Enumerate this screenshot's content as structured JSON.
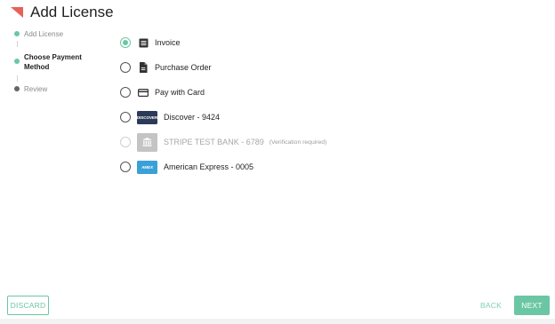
{
  "header": {
    "title": "Add License"
  },
  "steps": [
    {
      "label": "Add License",
      "state": "complete"
    },
    {
      "label": "Choose Payment Method",
      "state": "active"
    },
    {
      "label": "Review",
      "state": "pending"
    }
  ],
  "payment_options": [
    {
      "label": "Invoice",
      "icon": "invoice-icon",
      "selected": true
    },
    {
      "label": "Purchase Order",
      "icon": "purchase-order-icon",
      "selected": false
    },
    {
      "label": "Pay with Card",
      "icon": "credit-card-icon",
      "selected": false
    },
    {
      "label": "Discover - 9424",
      "icon": "discover-card-icon",
      "badge_text": "DISCOVER",
      "selected": false
    },
    {
      "label": "STRIPE TEST BANK - 6789",
      "note": "(Verification required)",
      "icon": "bank-icon",
      "selected": false,
      "disabled": true
    },
    {
      "label": "American Express - 0005",
      "icon": "amex-card-icon",
      "badge_text": "AMEX",
      "selected": false
    }
  ],
  "footer": {
    "discard_label": "DISCARD",
    "back_label": "BACK",
    "next_label": "NEXT"
  },
  "colors": {
    "accent": "#6bc7a3",
    "logo": "#e8605a",
    "discover_badge": "#2b3a56",
    "amex_badge": "#3aa0d8",
    "disabled_text": "#a7a7a7"
  }
}
